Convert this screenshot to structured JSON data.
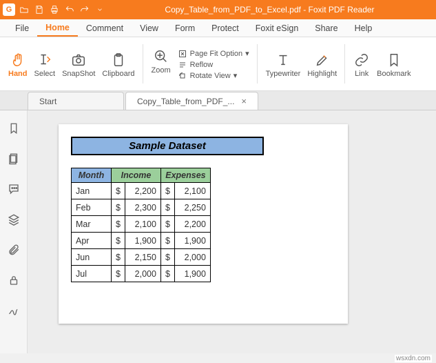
{
  "titlebar": {
    "app_title": "Copy_Table_from_PDF_to_Excel.pdf - Foxit PDF Reader",
    "logo_letter": "G"
  },
  "menu": {
    "file": "File",
    "home": "Home",
    "comment": "Comment",
    "view": "View",
    "form": "Form",
    "protect": "Protect",
    "esign": "Foxit eSign",
    "share": "Share",
    "help": "Help"
  },
  "ribbon": {
    "hand": "Hand",
    "select": "Select",
    "snapshot": "SnapShot",
    "clipboard": "Clipboard",
    "zoom": "Zoom",
    "pagefit": "Page Fit Option",
    "reflow": "Reflow",
    "rotate": "Rotate View",
    "typewriter": "Typewriter",
    "highlight": "Highlight",
    "link": "Link",
    "bookmark": "Bookmark"
  },
  "tabs": {
    "start": "Start",
    "doc": "Copy_Table_from_PDF_..."
  },
  "doc": {
    "title": "Sample Dataset",
    "headers": {
      "month": "Month",
      "income": "Income",
      "expenses": "Expenses"
    },
    "currency": "$",
    "rows": [
      {
        "m": "Jan",
        "inc": "2,200",
        "exp": "2,100"
      },
      {
        "m": "Feb",
        "inc": "2,300",
        "exp": "2,250"
      },
      {
        "m": "Mar",
        "inc": "2,100",
        "exp": "2,200"
      },
      {
        "m": "Apr",
        "inc": "1,900",
        "exp": "1,900"
      },
      {
        "m": "Jun",
        "inc": "2,150",
        "exp": "2,000"
      },
      {
        "m": "Jul",
        "inc": "2,000",
        "exp": "1,900"
      }
    ]
  },
  "watermark": "wsxdn.com",
  "chart_data": {
    "type": "table",
    "title": "Sample Dataset",
    "columns": [
      "Month",
      "Income",
      "Expenses"
    ],
    "rows": [
      [
        "Jan",
        2200,
        2100
      ],
      [
        "Feb",
        2300,
        2250
      ],
      [
        "Mar",
        2100,
        2200
      ],
      [
        "Apr",
        1900,
        1900
      ],
      [
        "Jun",
        2150,
        2000
      ],
      [
        "Jul",
        2000,
        1900
      ]
    ]
  }
}
